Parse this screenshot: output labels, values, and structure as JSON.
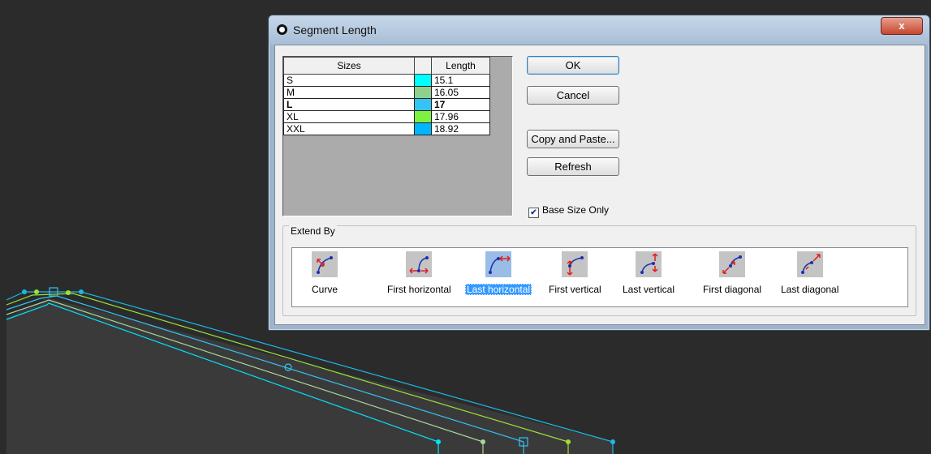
{
  "dialog": {
    "title": "Segment Length",
    "close_glyph": "x",
    "icon": "circle-app-icon"
  },
  "table": {
    "headers": [
      "Sizes",
      "",
      "Length"
    ],
    "rows": [
      {
        "size": "S",
        "color": "#00ffff",
        "length": "15.1"
      },
      {
        "size": "M",
        "color": "#8fd08f",
        "length": "16.05"
      },
      {
        "size": "L",
        "color": "#33c4f5",
        "length": "17",
        "base": true
      },
      {
        "size": "XL",
        "color": "#80f040",
        "length": "17.96"
      },
      {
        "size": "XXL",
        "color": "#00b7ff",
        "length": "18.92"
      }
    ]
  },
  "buttons": {
    "ok": "OK",
    "cancel": "Cancel",
    "copy_paste": "Copy and Paste...",
    "refresh": "Refresh"
  },
  "base_size_only": {
    "label": "Base Size Only",
    "checked": true
  },
  "extend_by": {
    "legend": "Extend By",
    "selected_index": 2,
    "options": [
      {
        "label": "Curve",
        "icon": "curve-icon"
      },
      {
        "label": "First horizontal",
        "icon": "first-horizontal-icon"
      },
      {
        "label": "Last horizontal",
        "icon": "last-horizontal-icon"
      },
      {
        "label": "First vertical",
        "icon": "first-vertical-icon"
      },
      {
        "label": "Last vertical",
        "icon": "last-vertical-icon"
      },
      {
        "label": "First diagonal",
        "icon": "first-diagonal-icon"
      },
      {
        "label": "Last diagonal",
        "icon": "last-diagonal-icon"
      }
    ]
  },
  "colors": {
    "canvas_bg": "#2b2b2b",
    "pattern_bg": "#3a3a3a",
    "line_cyan": "#1bb8e8",
    "line_green": "#9be23a",
    "line_pale_green": "#a7d89a"
  }
}
